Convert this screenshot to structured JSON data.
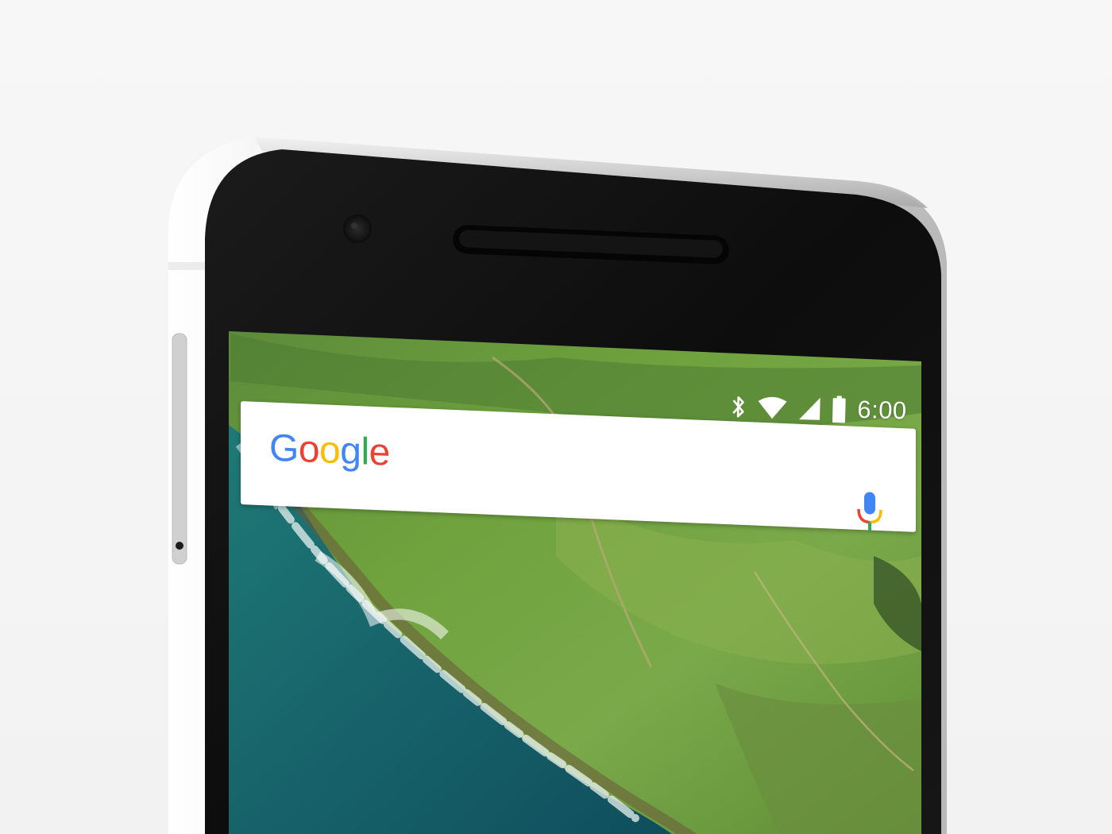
{
  "status_bar": {
    "time": "6:00",
    "icons": [
      "bluetooth-icon",
      "wifi-icon",
      "cell-signal-icon",
      "battery-icon"
    ]
  },
  "search_widget": {
    "logo_letters": [
      {
        "char": "G",
        "color": "#4285F4"
      },
      {
        "char": "o",
        "color": "#EA4335"
      },
      {
        "char": "o",
        "color": "#FBBC05"
      },
      {
        "char": "g",
        "color": "#4285F4"
      },
      {
        "char": "l",
        "color": "#34A853"
      },
      {
        "char": "e",
        "color": "#EA4335"
      }
    ],
    "mic_icon": "mic-icon"
  },
  "colors": {
    "background": "#f4f4f4",
    "phone_body": "#111111",
    "aluminum_frame": "#d9d9d9",
    "google_blue": "#4285F4",
    "google_red": "#EA4335",
    "google_yellow": "#FBBC05",
    "google_green": "#34A853"
  }
}
